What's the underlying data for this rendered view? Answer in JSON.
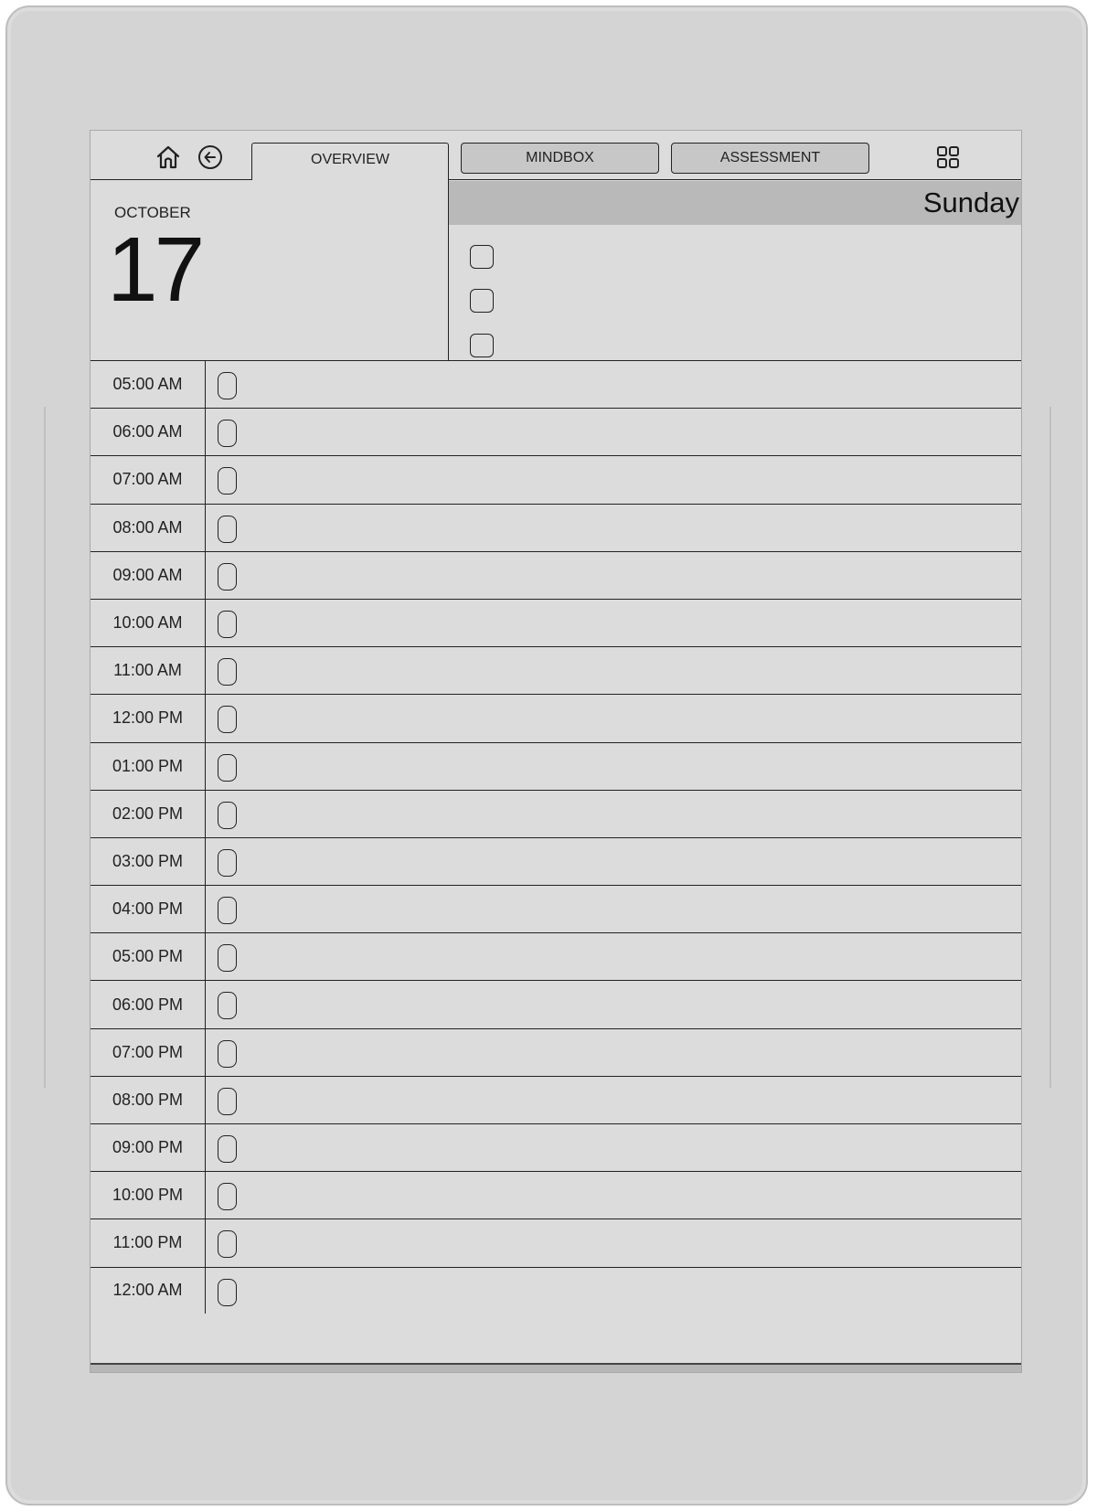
{
  "nav": {
    "home_icon": "home-icon",
    "back_icon": "back-arrow-circle-icon",
    "tabs": [
      {
        "label": "OVERVIEW",
        "active": true
      },
      {
        "label": "MINDBOX",
        "active": false
      },
      {
        "label": "ASSESSMENT",
        "active": false
      }
    ],
    "grid_icon": "grid-icon"
  },
  "date": {
    "month": "OCTOBER",
    "day": "17",
    "weekday": "Sunday"
  },
  "todos": [
    {
      "checked": false
    },
    {
      "checked": false
    },
    {
      "checked": false
    }
  ],
  "schedule": [
    {
      "time": "05:00 AM"
    },
    {
      "time": "06:00 AM"
    },
    {
      "time": "07:00 AM"
    },
    {
      "time": "08:00 AM"
    },
    {
      "time": "09:00 AM"
    },
    {
      "time": "10:00 AM"
    },
    {
      "time": "11:00 AM"
    },
    {
      "time": "12:00 PM"
    },
    {
      "time": "01:00 PM"
    },
    {
      "time": "02:00 PM"
    },
    {
      "time": "03:00 PM"
    },
    {
      "time": "04:00 PM"
    },
    {
      "time": "05:00 PM"
    },
    {
      "time": "06:00 PM"
    },
    {
      "time": "07:00 PM"
    },
    {
      "time": "08:00 PM"
    },
    {
      "time": "09:00 PM"
    },
    {
      "time": "10:00 PM"
    },
    {
      "time": "11:00 PM"
    },
    {
      "time": "12:00 AM"
    }
  ],
  "colors": {
    "screen": "#dcdcdc",
    "weekday_bar": "#b9b9b9",
    "tab_inactive": "#c7c7c7",
    "ink": "#222222",
    "device_frame": "#d4d4d4"
  }
}
